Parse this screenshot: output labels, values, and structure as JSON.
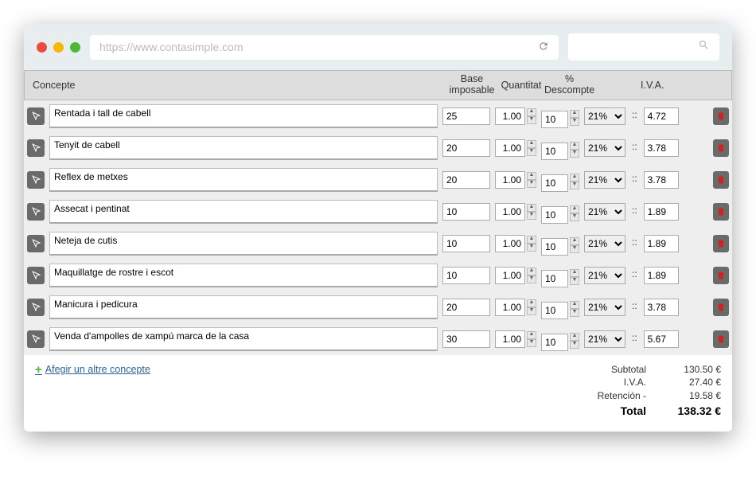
{
  "browser": {
    "url": "https://www.contasimple.com"
  },
  "headers": {
    "concepte": "Concepte",
    "base": "Base imposable",
    "quantitat": "Quantitat",
    "descompte": "% Descompte",
    "iva": "I.V.A."
  },
  "rows": [
    {
      "concepte": "Rentada i tall de cabell",
      "base": "25",
      "qty": "1.00",
      "desc": "10",
      "iva_pct": "21%",
      "iva_amt": "4.72"
    },
    {
      "concepte": "Tenyit de cabell",
      "base": "20",
      "qty": "1.00",
      "desc": "10",
      "iva_pct": "21%",
      "iva_amt": "3.78"
    },
    {
      "concepte": "Reflex de metxes",
      "base": "20",
      "qty": "1.00",
      "desc": "10",
      "iva_pct": "21%",
      "iva_amt": "3.78"
    },
    {
      "concepte": "Assecat i pentinat",
      "base": "10",
      "qty": "1.00",
      "desc": "10",
      "iva_pct": "21%",
      "iva_amt": "1.89"
    },
    {
      "concepte": "Neteja de cutis",
      "base": "10",
      "qty": "1.00",
      "desc": "10",
      "iva_pct": "21%",
      "iva_amt": "1.89"
    },
    {
      "concepte": "Maquillatge de rostre i escot",
      "base": "10",
      "qty": "1.00",
      "desc": "10",
      "iva_pct": "21%",
      "iva_amt": "1.89"
    },
    {
      "concepte": "Manicura i pedicura",
      "base": "20",
      "qty": "1.00",
      "desc": "10",
      "iva_pct": "21%",
      "iva_amt": "3.78"
    },
    {
      "concepte": "Venda d'ampolles de xampú marca de la casa",
      "base": "30",
      "qty": "1.00",
      "desc": "10",
      "iva_pct": "21%",
      "iva_amt": "5.67"
    }
  ],
  "iva_sep": "::",
  "add_link": "Afegir un altre concepte",
  "totals": {
    "subtotal_label": "Subtotal",
    "subtotal_value": "130.50 €",
    "iva_label": "I.V.A.",
    "iva_value": "27.40 €",
    "retencion_label": "Retención -",
    "retencion_value": "19.58 €",
    "total_label": "Total",
    "total_value": "138.32 €"
  }
}
